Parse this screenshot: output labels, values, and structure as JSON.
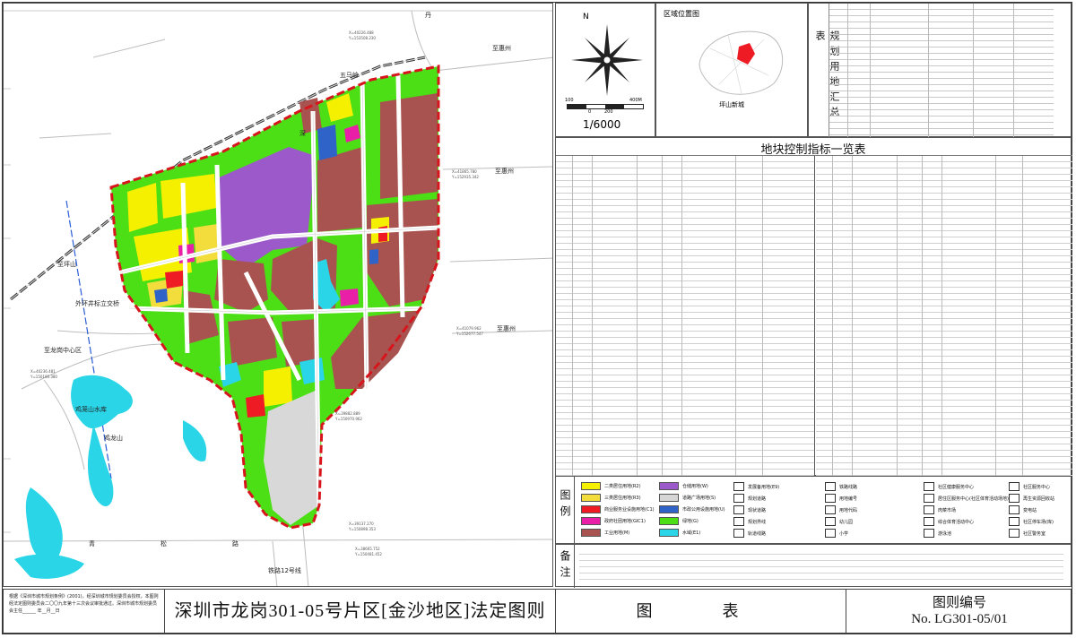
{
  "map": {
    "labels": {
      "wumaling": "五马岭",
      "to_huizhou_1": "至惠州",
      "to_huizhou_2": "至惠州",
      "to_huizhou_3": "至惠州",
      "outer_ring": "外环井标立交桥",
      "to_pingshan": "至坪山",
      "to_longgang_hub": "至龙岗中心区",
      "water_reservoir": "鸡笼山水库",
      "jiulong_shan": "鸡龙山",
      "road_qing": "青",
      "road_song": "松",
      "road_lu": "路",
      "road_rail": "铁路12号线",
      "road_shen": "深",
      "road_dan": "丹"
    },
    "coords": [
      "X=40226.488",
      "Y=153508.230",
      "X=41865.780",
      "Y=152935.342",
      "X=40236.481",
      "Y=150190.380",
      "X=39882.889",
      "Y=150970.962",
      "X=39137.270",
      "Y=150898.353",
      "X=38665.752",
      "Y=150481.452",
      "X=41079.962",
      "Y=152677.547"
    ]
  },
  "north_panel": {
    "north_letter": "N",
    "scale_ticks": [
      "100",
      "0",
      "200",
      "400M"
    ],
    "scale_ratio": "1/6000",
    "region_title": "区域位置图",
    "region_label": "坪山新城"
  },
  "summary_table": {
    "title": "规划用地汇总表"
  },
  "control_table": {
    "title": "地块控制指标一览表"
  },
  "legend": {
    "title": "图例",
    "items": [
      {
        "label": "二类居住用地(R2)",
        "color": "#f5f000"
      },
      {
        "label": "三类居住用地(R3)",
        "color": "#f2dd3c"
      },
      {
        "label": "商业服务业设施用地(C1)",
        "color": "#ee1b24"
      },
      {
        "label": "政府社团用地(GIC1)",
        "color": "#e91fa8"
      },
      {
        "label": "工业用地(M)",
        "color": "#a8534f"
      },
      {
        "label": "仓储用地(W)",
        "color": "#9b59c9"
      },
      {
        "label": "道路广场用地(S)",
        "color": "#d6d6d6"
      },
      {
        "label": "市政公用设施用地(U)",
        "color": "#2f63c8"
      },
      {
        "label": "绿地(G)",
        "color": "#4cdf16"
      },
      {
        "label": "水域(E1)",
        "color": "#2ad5e8"
      },
      {
        "label": "发展备用地(E9)",
        "color": "#ffffff"
      },
      {
        "label": "规划道路",
        "color": "#ffffff"
      },
      {
        "label": "现状道路",
        "color": "#ffffff"
      },
      {
        "label": "规划界线",
        "color": "#ffffff"
      },
      {
        "label": "轨道线路",
        "color": "#ffffff"
      },
      {
        "label": "铁路线路",
        "color": "#ffffff"
      },
      {
        "label": "用地编号",
        "color": "#ffffff"
      },
      {
        "label": "用地代码",
        "color": "#ffffff"
      },
      {
        "label": "幼儿园",
        "color": "#ffffff"
      },
      {
        "label": "小学",
        "color": "#ffffff"
      },
      {
        "label": "社区健康服务中心",
        "color": "#ffffff"
      },
      {
        "label": "居住区服务中心(社区体育活动场地)",
        "color": "#ffffff"
      },
      {
        "label": "肉菜市场",
        "color": "#ffffff"
      },
      {
        "label": "综合体育活动中心",
        "color": "#ffffff"
      },
      {
        "label": "游泳池",
        "color": "#ffffff"
      },
      {
        "label": "社区服务中心",
        "color": "#ffffff"
      },
      {
        "label": "再生资源回收站",
        "color": "#ffffff"
      },
      {
        "label": "变电站",
        "color": "#ffffff"
      },
      {
        "label": "社区停车场(库)",
        "color": "#ffffff"
      },
      {
        "label": "社区警务室",
        "color": "#ffffff"
      },
      {
        "label": "人行天桥",
        "color": "#ffffff"
      },
      {
        "label": "公交首末站",
        "color": "#ffffff"
      },
      {
        "label": "加气站",
        "color": "#ffffff"
      },
      {
        "label": "邮电所",
        "color": "#ffffff"
      },
      {
        "label": "垃圾转运站",
        "color": "#ffffff"
      },
      {
        "label": "安全岗站",
        "color": "#ffffff"
      },
      {
        "label": "公共厕所",
        "color": "#ffffff"
      },
      {
        "label": "环卫工人休息场",
        "color": "#ffffff"
      }
    ]
  },
  "notes": {
    "title": "备注"
  },
  "title_block": {
    "left_note": "根据《深圳市城市规划条例》(2001)，经深圳城市规划委员会授权，本图则经法定图则委员会二〇〇九年第十三次会议审批通过。深圳市城市规划委员会主任______ 年__月__日",
    "main_title": "深圳市龙岗301-05号片区[金沙地区]法定图则",
    "figure_label": "图　表",
    "figure_no_label": "图则编号",
    "figure_no": "No. LG301-05/01"
  }
}
